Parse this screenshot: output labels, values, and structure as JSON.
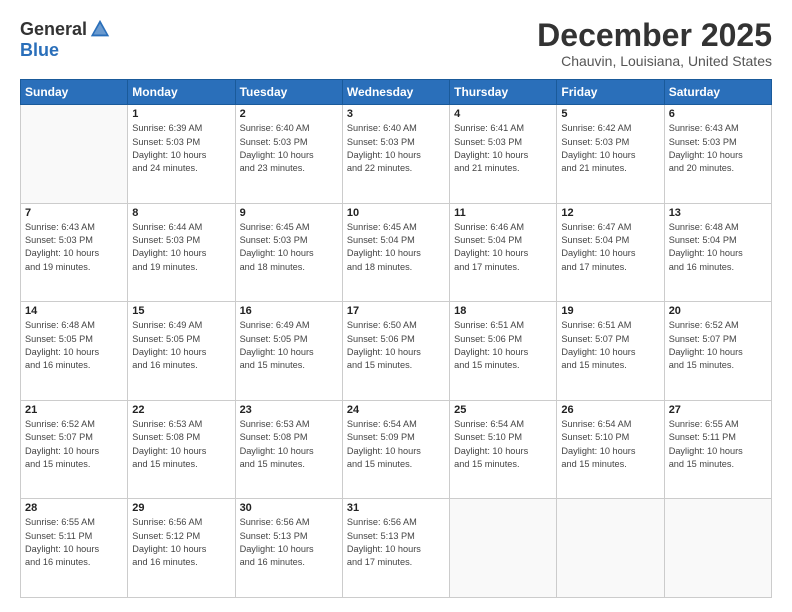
{
  "logo": {
    "general": "General",
    "blue": "Blue"
  },
  "header": {
    "month": "December 2025",
    "location": "Chauvin, Louisiana, United States"
  },
  "weekdays": [
    "Sunday",
    "Monday",
    "Tuesday",
    "Wednesday",
    "Thursday",
    "Friday",
    "Saturday"
  ],
  "weeks": [
    [
      {
        "day": "",
        "info": ""
      },
      {
        "day": "1",
        "info": "Sunrise: 6:39 AM\nSunset: 5:03 PM\nDaylight: 10 hours\nand 24 minutes."
      },
      {
        "day": "2",
        "info": "Sunrise: 6:40 AM\nSunset: 5:03 PM\nDaylight: 10 hours\nand 23 minutes."
      },
      {
        "day": "3",
        "info": "Sunrise: 6:40 AM\nSunset: 5:03 PM\nDaylight: 10 hours\nand 22 minutes."
      },
      {
        "day": "4",
        "info": "Sunrise: 6:41 AM\nSunset: 5:03 PM\nDaylight: 10 hours\nand 21 minutes."
      },
      {
        "day": "5",
        "info": "Sunrise: 6:42 AM\nSunset: 5:03 PM\nDaylight: 10 hours\nand 21 minutes."
      },
      {
        "day": "6",
        "info": "Sunrise: 6:43 AM\nSunset: 5:03 PM\nDaylight: 10 hours\nand 20 minutes."
      }
    ],
    [
      {
        "day": "7",
        "info": "Sunrise: 6:43 AM\nSunset: 5:03 PM\nDaylight: 10 hours\nand 19 minutes."
      },
      {
        "day": "8",
        "info": "Sunrise: 6:44 AM\nSunset: 5:03 PM\nDaylight: 10 hours\nand 19 minutes."
      },
      {
        "day": "9",
        "info": "Sunrise: 6:45 AM\nSunset: 5:03 PM\nDaylight: 10 hours\nand 18 minutes."
      },
      {
        "day": "10",
        "info": "Sunrise: 6:45 AM\nSunset: 5:04 PM\nDaylight: 10 hours\nand 18 minutes."
      },
      {
        "day": "11",
        "info": "Sunrise: 6:46 AM\nSunset: 5:04 PM\nDaylight: 10 hours\nand 17 minutes."
      },
      {
        "day": "12",
        "info": "Sunrise: 6:47 AM\nSunset: 5:04 PM\nDaylight: 10 hours\nand 17 minutes."
      },
      {
        "day": "13",
        "info": "Sunrise: 6:48 AM\nSunset: 5:04 PM\nDaylight: 10 hours\nand 16 minutes."
      }
    ],
    [
      {
        "day": "14",
        "info": "Sunrise: 6:48 AM\nSunset: 5:05 PM\nDaylight: 10 hours\nand 16 minutes."
      },
      {
        "day": "15",
        "info": "Sunrise: 6:49 AM\nSunset: 5:05 PM\nDaylight: 10 hours\nand 16 minutes."
      },
      {
        "day": "16",
        "info": "Sunrise: 6:49 AM\nSunset: 5:05 PM\nDaylight: 10 hours\nand 15 minutes."
      },
      {
        "day": "17",
        "info": "Sunrise: 6:50 AM\nSunset: 5:06 PM\nDaylight: 10 hours\nand 15 minutes."
      },
      {
        "day": "18",
        "info": "Sunrise: 6:51 AM\nSunset: 5:06 PM\nDaylight: 10 hours\nand 15 minutes."
      },
      {
        "day": "19",
        "info": "Sunrise: 6:51 AM\nSunset: 5:07 PM\nDaylight: 10 hours\nand 15 minutes."
      },
      {
        "day": "20",
        "info": "Sunrise: 6:52 AM\nSunset: 5:07 PM\nDaylight: 10 hours\nand 15 minutes."
      }
    ],
    [
      {
        "day": "21",
        "info": "Sunrise: 6:52 AM\nSunset: 5:07 PM\nDaylight: 10 hours\nand 15 minutes."
      },
      {
        "day": "22",
        "info": "Sunrise: 6:53 AM\nSunset: 5:08 PM\nDaylight: 10 hours\nand 15 minutes."
      },
      {
        "day": "23",
        "info": "Sunrise: 6:53 AM\nSunset: 5:08 PM\nDaylight: 10 hours\nand 15 minutes."
      },
      {
        "day": "24",
        "info": "Sunrise: 6:54 AM\nSunset: 5:09 PM\nDaylight: 10 hours\nand 15 minutes."
      },
      {
        "day": "25",
        "info": "Sunrise: 6:54 AM\nSunset: 5:10 PM\nDaylight: 10 hours\nand 15 minutes."
      },
      {
        "day": "26",
        "info": "Sunrise: 6:54 AM\nSunset: 5:10 PM\nDaylight: 10 hours\nand 15 minutes."
      },
      {
        "day": "27",
        "info": "Sunrise: 6:55 AM\nSunset: 5:11 PM\nDaylight: 10 hours\nand 15 minutes."
      }
    ],
    [
      {
        "day": "28",
        "info": "Sunrise: 6:55 AM\nSunset: 5:11 PM\nDaylight: 10 hours\nand 16 minutes."
      },
      {
        "day": "29",
        "info": "Sunrise: 6:56 AM\nSunset: 5:12 PM\nDaylight: 10 hours\nand 16 minutes."
      },
      {
        "day": "30",
        "info": "Sunrise: 6:56 AM\nSunset: 5:13 PM\nDaylight: 10 hours\nand 16 minutes."
      },
      {
        "day": "31",
        "info": "Sunrise: 6:56 AM\nSunset: 5:13 PM\nDaylight: 10 hours\nand 17 minutes."
      },
      {
        "day": "",
        "info": ""
      },
      {
        "day": "",
        "info": ""
      },
      {
        "day": "",
        "info": ""
      }
    ]
  ]
}
